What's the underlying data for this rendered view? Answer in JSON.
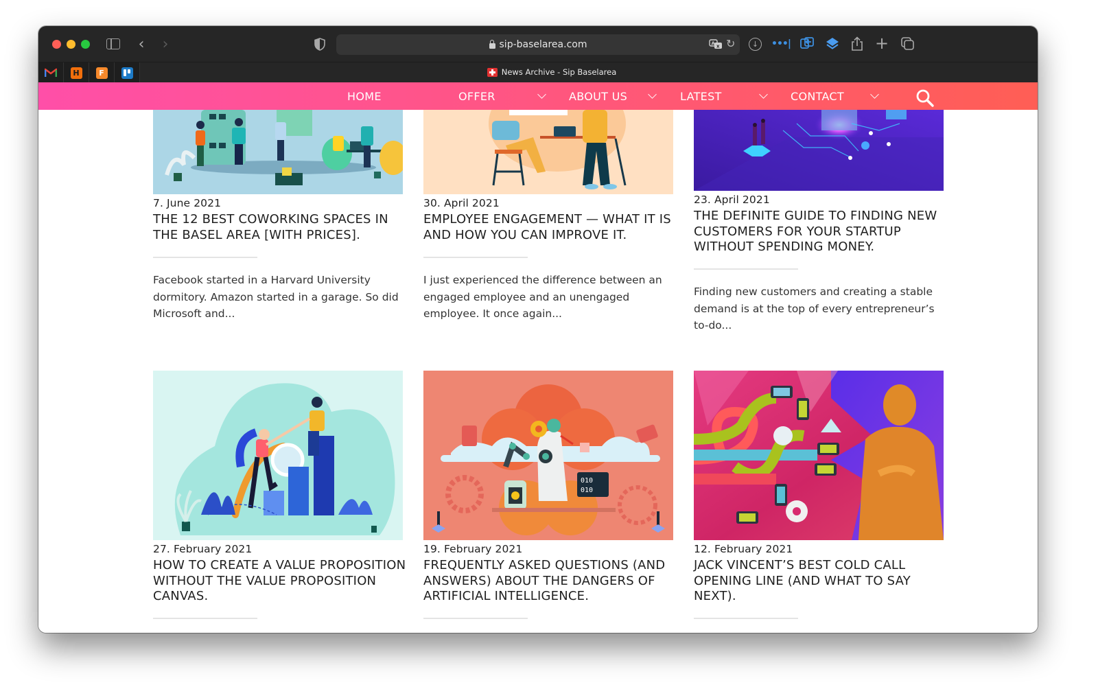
{
  "browser": {
    "url": "sip-baselarea.com",
    "tab_title": "News Archive - Sip Baselarea",
    "pinned_tabs": [
      {
        "name": "gmail",
        "glyph": "M"
      },
      {
        "name": "h-app",
        "glyph": "H"
      },
      {
        "name": "f-app",
        "glyph": "F"
      },
      {
        "name": "trello",
        "glyph": ""
      }
    ],
    "icons": {
      "back": "‹",
      "forward": "›",
      "reload": "↻",
      "download": "↓",
      "plus": "+",
      "dots": "•••|"
    }
  },
  "nav": {
    "items": [
      {
        "label": "HOME",
        "dropdown": false
      },
      {
        "label": "OFFER",
        "dropdown": true
      },
      {
        "label": "ABOUT US",
        "dropdown": true
      },
      {
        "label": "LATEST",
        "dropdown": true
      },
      {
        "label": "CONTACT",
        "dropdown": true
      }
    ],
    "gradient": [
      "#ff4fa8",
      "#ff5e55"
    ]
  },
  "posts": [
    {
      "date": "7. June 2021",
      "title": "THE 12 BEST COWORKING SPACES IN THE BASEL AREA [WITH PRICES].",
      "excerpt": "Facebook started in a Harvard University dormitory. Amazon started in a garage. So did Microsoft and...",
      "image_bg": "#acd6e6"
    },
    {
      "date": "30. April 2021",
      "title": "EMPLOYEE ENGAGEMENT — WHAT IT IS AND HOW YOU CAN IMPROVE IT.",
      "excerpt": "I just experienced the difference between an engaged employee and an unengaged employee. It once again...",
      "image_bg": "#ffe0c2"
    },
    {
      "date": "23. April 2021",
      "title": "THE DEFINITE GUIDE TO FINDING NEW CUSTOMERS FOR YOUR STARTUP WITHOUT SPENDING MONEY.",
      "excerpt": "Finding new customers and creating a stable demand is at the top of every entrepreneur’s to-do...",
      "image_bg": "#4a22b8"
    },
    {
      "date": "27. February 2021",
      "title": "HOW TO CREATE A VALUE PROPOSITION WITHOUT THE VALUE PROPOSITION CANVAS.",
      "excerpt": "",
      "image_bg": "#cdf1ee"
    },
    {
      "date": "19. February 2021",
      "title": "FREQUENTLY ASKED QUESTIONS (AND ANSWERS) ABOUT THE DANGERS OF ARTIFICIAL INTELLIGENCE.",
      "excerpt": "",
      "image_bg": "#ee8672"
    },
    {
      "date": "12. February 2021",
      "title": "JACK VINCENT’S BEST COLD CALL OPENING LINE (AND WHAT TO SAY NEXT).",
      "excerpt": "",
      "image_bg": "#d7306e"
    }
  ]
}
